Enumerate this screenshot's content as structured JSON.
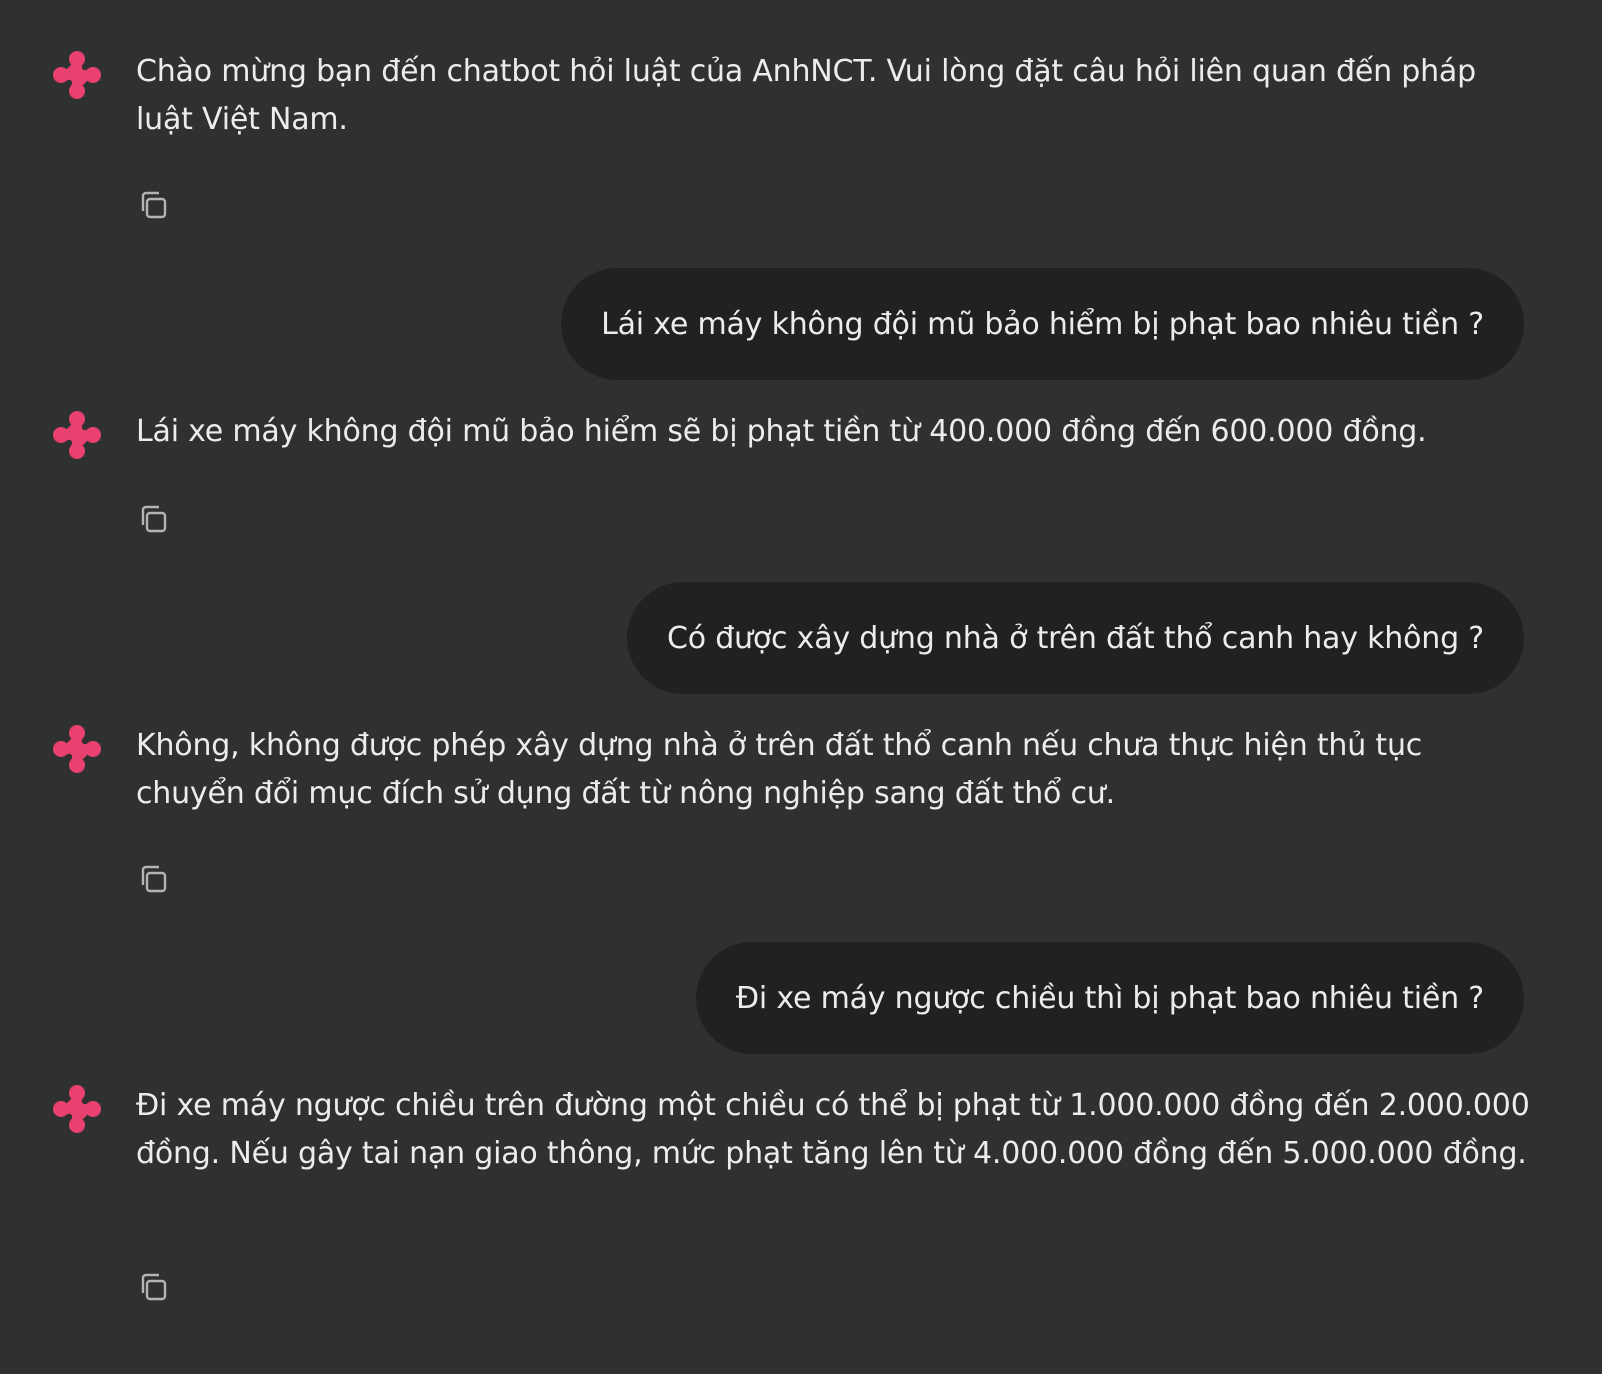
{
  "theme": {
    "background": "#303030",
    "user_bubble": "#212121",
    "text": "#ececec",
    "accent_logo": "#e8416f",
    "icon": "#b4b4b4"
  },
  "messages": [
    {
      "role": "bot",
      "text": "Chào mừng bạn đến chatbot hỏi luật của AnhNCT. Vui lòng đặt câu hỏi liên quan đến pháp luật Việt Nam.",
      "icons": [
        "logo-icon",
        "copy-icon"
      ]
    },
    {
      "role": "user",
      "text": "Lái xe máy không đội mũ bảo hiểm bị phạt bao nhiêu tiền ?"
    },
    {
      "role": "bot",
      "text": "Lái xe máy không đội mũ bảo hiểm sẽ bị phạt tiền từ 400.000 đồng đến 600.000 đồng.",
      "icons": [
        "logo-icon",
        "copy-icon"
      ]
    },
    {
      "role": "user",
      "text": "Có được xây dựng nhà ở trên đất thổ canh hay không ?"
    },
    {
      "role": "bot",
      "text": "Không, không được phép xây dựng nhà ở trên đất thổ canh nếu chưa thực hiện thủ tục chuyển đổi mục đích sử dụng đất từ nông nghiệp sang đất thổ cư.",
      "icons": [
        "logo-icon",
        "copy-icon"
      ]
    },
    {
      "role": "user",
      "text": "Đi xe máy ngược chiều thì bị phạt bao nhiêu tiền ?"
    },
    {
      "role": "bot",
      "text": "Đi xe máy ngược chiều trên đường một chiều có thể bị phạt từ 1.000.000 đồng đến 2.000.000 đồng. Nếu gây tai nạn giao thông, mức phạt tăng lên từ 4.000.000 đồng đến 5.000.000 đồng.",
      "icons": [
        "logo-icon",
        "copy-icon"
      ]
    }
  ]
}
